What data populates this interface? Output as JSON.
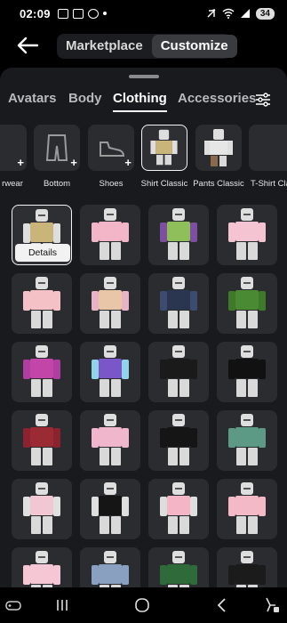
{
  "status": {
    "time": "02:09",
    "battery": "34"
  },
  "header": {
    "marketplace": "Marketplace",
    "customize": "Customize"
  },
  "tabs": [
    "Avatars",
    "Body",
    "Clothing",
    "Accessories"
  ],
  "categories": [
    "rwear",
    "Bottom",
    "Shoes",
    "Shirt Classic",
    "Pants Classic",
    "T-Shirt Cla"
  ],
  "details_label": "Details",
  "accent": "#ffffff",
  "items": [
    {
      "torso": "#c9b47a",
      "arm": "#dedede"
    },
    {
      "torso": "#f2b6c8",
      "arm": "#f2b6c8"
    },
    {
      "torso": "#8fbf5a",
      "arm": "#7c4fa0"
    },
    {
      "torso": "#f4c4d2",
      "arm": "#f4c4d2"
    },
    {
      "torso": "#f4c2c6",
      "arm": "#f4c2c6"
    },
    {
      "torso": "#e9c6a8",
      "arm": "#e7b3c5"
    },
    {
      "torso": "#2a3550",
      "arm": "#3c4c70"
    },
    {
      "torso": "#4a8a32",
      "arm": "#3e7a2a"
    },
    {
      "torso": "#c246a8",
      "arm": "#b03ea0"
    },
    {
      "torso": "#7a56c8",
      "arm": "#8fd4e8"
    },
    {
      "torso": "#1a1a1a",
      "arm": "#1a1a1a"
    },
    {
      "torso": "#111111",
      "arm": "#111111"
    },
    {
      "torso": "#9a2a34",
      "arm": "#8a2230"
    },
    {
      "torso": "#f0b7cc",
      "arm": "#f0b7cc"
    },
    {
      "torso": "#151515",
      "arm": "#151515"
    },
    {
      "torso": "#5d9a86",
      "arm": "#5d9a86"
    },
    {
      "torso": "#f1c7d4",
      "arm": "#e0e0e0"
    },
    {
      "torso": "#151515",
      "arm": "#dedede"
    },
    {
      "torso": "#f4b6c6",
      "arm": "#dedede"
    },
    {
      "torso": "#f3b9c7",
      "arm": "#f3b9c7"
    },
    {
      "torso": "#f5c6d3",
      "arm": "#f5c6d3"
    },
    {
      "torso": "#8aa0c0",
      "arm": "#8aa0c0"
    },
    {
      "torso": "#2f6a3a",
      "arm": "#2f6a3a"
    },
    {
      "torso": "#1b1b1b",
      "arm": "#1b1b1b"
    }
  ]
}
